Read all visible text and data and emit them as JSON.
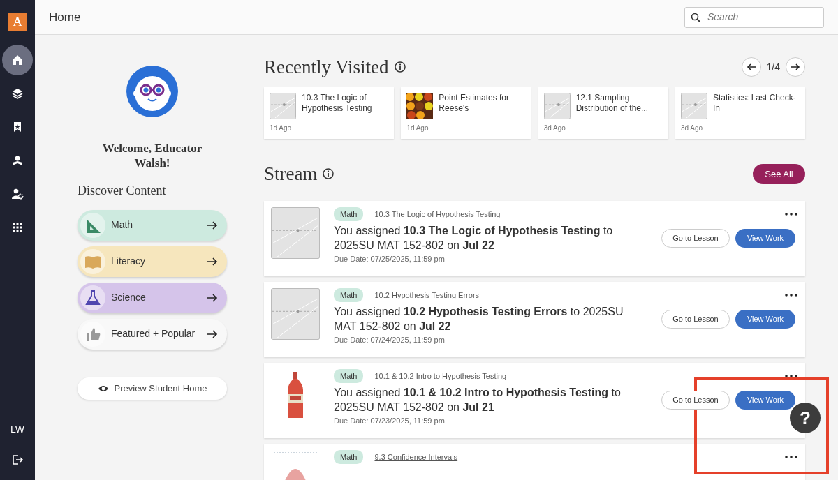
{
  "sidebar": {
    "logo": "A",
    "items": [
      {
        "kind": "home",
        "selected": true
      },
      {
        "kind": "layers",
        "selected": false
      },
      {
        "kind": "bookmark",
        "selected": false
      },
      {
        "kind": "reader",
        "selected": false
      },
      {
        "kind": "usergear",
        "selected": false
      },
      {
        "kind": "grid",
        "selected": false
      }
    ],
    "user_initials": "LW"
  },
  "header": {
    "title": "Home",
    "search": {
      "placeholder": "Search"
    }
  },
  "profile": {
    "welcome": "Welcome, Educator Walsh!",
    "discover_title": "Discover Content",
    "discover": [
      {
        "label": "Math",
        "kind": "math",
        "color": "#cdeadf"
      },
      {
        "label": "Literacy",
        "kind": "literacy",
        "color": "#f6e6bd"
      },
      {
        "label": "Science",
        "kind": "science",
        "color": "#d5c4ea"
      },
      {
        "label": "Featured + Popular",
        "kind": "featured",
        "color": "#f8f8f8"
      }
    ],
    "preview_button": "Preview Student Home"
  },
  "recently_visited": {
    "title": "Recently Visited",
    "pager": "1/4",
    "items": [
      {
        "title": "10.3 The Logic of Hypothesis Testing",
        "time": "1d Ago",
        "thumb": {
          "kind": "graph"
        }
      },
      {
        "title": "Point Estimates for Reese's",
        "time": "1d Ago"
      },
      {
        "title": "12.1 Sampling Distribution of the...",
        "time": "3d Ago",
        "thumb": {
          "kind": "graph"
        }
      },
      {
        "title": "Statistics: Last Check-In",
        "time": "3d Ago",
        "thumb": {
          "kind": "graph"
        }
      }
    ]
  },
  "stream": {
    "title": "Stream",
    "see_all": "See All",
    "items": [
      {
        "tag": "Math",
        "link": "10.3 The Logic of Hypothesis Testing",
        "text": "You assigned **10.3 The Logic of Hypothesis Testing** to 2025SU MAT 152-802 on **Jul 22**",
        "due": "Due Date: 07/25/2025, 11:59 pm",
        "thumb": {
          "kind": "graph"
        },
        "buttons": [
          "Go to Lesson",
          "View Work"
        ]
      },
      {
        "tag": "Math",
        "link": "10.2 Hypothesis Testing Errors",
        "text": "You assigned **10.2 Hypothesis Testing Errors** to 2025SU MAT 152-802 on **Jul 22**",
        "due": "Due Date: 07/24/2025, 11:59 pm",
        "thumb": {
          "kind": "graph"
        },
        "buttons": [
          "Go to Lesson",
          "View Work"
        ]
      },
      {
        "tag": "Math",
        "link": "10.1 & 10.2 Intro to Hypothesis Testing",
        "text": "You assigned **10.1 & 10.2 Intro to Hypothesis Testing** to 2025SU MAT 152-802 on **Jul 21**",
        "due": "Due Date: 07/23/2025, 11:59 pm",
        "buttons": [
          "Go to Lesson",
          "View Work"
        ]
      },
      {
        "tag": "Math",
        "link": "9.3 Confidence Intervals"
      }
    ]
  },
  "help_button": "?",
  "highlight": {
    "color": "#e5402a"
  }
}
